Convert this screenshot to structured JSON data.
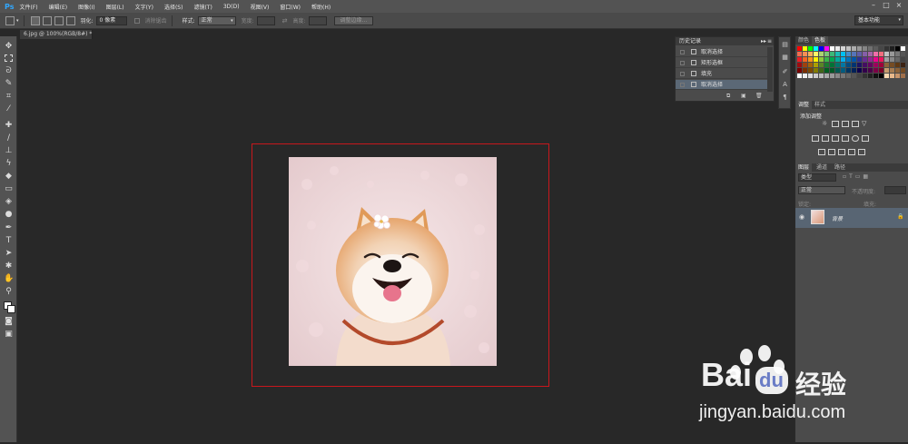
{
  "app": {
    "logo": "Ps"
  },
  "menubar": {
    "items": [
      "文件(F)",
      "编辑(E)",
      "图像(I)",
      "图层(L)",
      "文字(Y)",
      "选择(S)",
      "滤镜(T)",
      "3D(D)",
      "视图(V)",
      "窗口(W)",
      "帮助(H)"
    ]
  },
  "options": {
    "feather_label": "羽化:",
    "feather_value": "0 像素",
    "antialias_label": "消除锯齿",
    "style_label": "样式:",
    "style_value": "正常",
    "width_label": "宽度:",
    "height_label": "高度:",
    "refine_edge": "调整边缘...",
    "workspace": "基本功能"
  },
  "document": {
    "tab": "6.jpg @ 100%(RGB/8#) *"
  },
  "history": {
    "title": "历史记录",
    "steps": [
      {
        "label": "取消选择"
      },
      {
        "label": "矩形选框"
      },
      {
        "label": "填充"
      },
      {
        "label": "取消选择"
      }
    ]
  },
  "swatches": {
    "tab_color": "颜色",
    "tab_swatches": "色板"
  },
  "adjustments": {
    "tab_adjust": "调整",
    "tab_styles": "样式",
    "add_label": "添加调整"
  },
  "layers": {
    "tabs": [
      "图层",
      "通道",
      "路径"
    ],
    "filter_kind": "类型",
    "blend_mode": "正常",
    "opacity_label": "不透明度:",
    "lock_label": "锁定:",
    "fill_label": "填充:",
    "layer_name": "背景"
  },
  "watermark": {
    "brand": "Bai",
    "brand2": "du",
    "suffix": "经验",
    "url": "jingyan.baidu.com"
  },
  "colors": {
    "highlight": "#c8171c",
    "menubar": "#535353",
    "panel": "#4b4b4b",
    "workspace_bg": "#282828"
  }
}
